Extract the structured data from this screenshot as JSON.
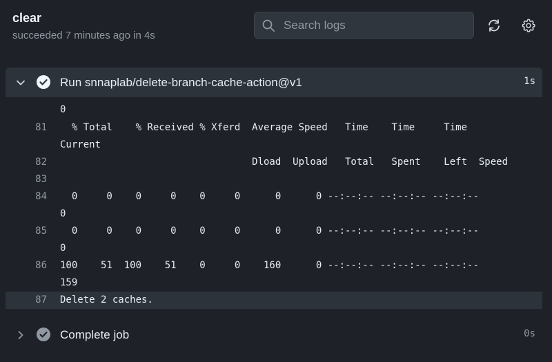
{
  "header": {
    "title": "clear",
    "status": "succeeded 7 minutes ago in 4s"
  },
  "search": {
    "placeholder": "Search logs",
    "value": ""
  },
  "steps": [
    {
      "name": "Run snnaplab/delete-branch-cache-action@v1",
      "duration": "1s",
      "expanded": true,
      "status": "success"
    },
    {
      "name": "Complete job",
      "duration": "0s",
      "expanded": false,
      "status": "success"
    }
  ],
  "log": {
    "lines": [
      {
        "num": "",
        "text": "0"
      },
      {
        "num": "81",
        "text": "  % Total    % Received % Xferd  Average Speed   Time    Time     Time"
      },
      {
        "num": "",
        "text": "Current"
      },
      {
        "num": "82",
        "text": "                                 Dload  Upload   Total   Spent    Left  Speed"
      },
      {
        "num": "83",
        "text": ""
      },
      {
        "num": "84",
        "text": "  0     0    0     0    0     0      0      0 --:--:-- --:--:-- --:--:--"
      },
      {
        "num": "",
        "text": "0"
      },
      {
        "num": "85",
        "text": "  0     0    0     0    0     0      0      0 --:--:-- --:--:-- --:--:--"
      },
      {
        "num": "",
        "text": "0"
      },
      {
        "num": "86",
        "text": "100    51  100    51    0     0    160      0 --:--:-- --:--:-- --:--:--"
      },
      {
        "num": "",
        "text": "159"
      },
      {
        "num": "87",
        "text": "Delete 2 caches.",
        "highlight": true
      }
    ]
  },
  "colors": {
    "background": "#1e2228",
    "panel": "#2d333b",
    "success_check": "#f0f6fc",
    "muted": "#9198a1"
  }
}
